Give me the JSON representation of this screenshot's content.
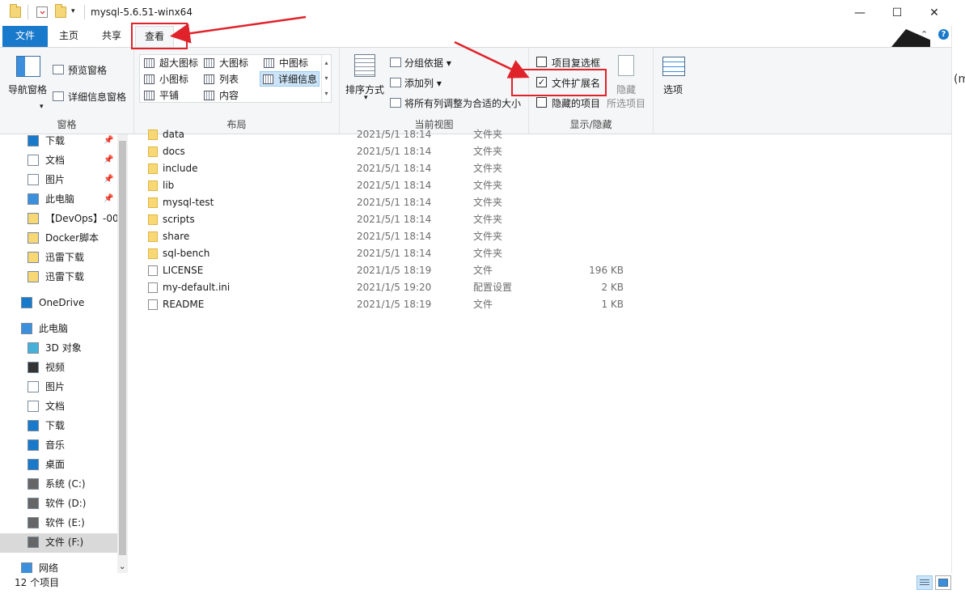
{
  "window": {
    "title": "mysql-5.6.51-winx64",
    "controls": {
      "minimize": "—",
      "maximize": "☐",
      "close": "✕"
    },
    "overflow_char": "(m"
  },
  "tabs": {
    "file": "文件",
    "home": "主页",
    "share": "共享",
    "view": "查看"
  },
  "ribbon": {
    "help_glyph": "?",
    "collapse_glyph": "⌃",
    "panes": {
      "nav_pane": "导航窗格",
      "preview_pane": "预览窗格",
      "details_pane": "详细信息窗格",
      "group_label": "窗格"
    },
    "layout": {
      "extra_large": "超大图标",
      "large": "大图标",
      "medium": "中图标",
      "small": "小图标",
      "list": "列表",
      "details": "详细信息",
      "tiles": "平铺",
      "content": "内容",
      "group_label": "布局"
    },
    "current_view": {
      "sort_by": "排序方式",
      "group_by": "分组依据",
      "add_columns": "添加列",
      "size_all_columns": "将所有列调整为合适的大小",
      "group_label": "当前视图"
    },
    "show_hide": {
      "item_checkboxes": {
        "label": "项目复选框",
        "checked": false
      },
      "file_extensions": {
        "label": "文件扩展名",
        "checked": true
      },
      "hidden_items": {
        "label": "隐藏的项目",
        "checked": false
      },
      "hide_selected_line1": "隐藏",
      "hide_selected_line2": "所选项目",
      "group_label": "显示/隐藏"
    },
    "options": "选项",
    "check_mark": "✓"
  },
  "nav": {
    "pin_glyph": "📌",
    "expand_glyph": "⌄",
    "items": [
      {
        "label": "下载",
        "pinned": true
      },
      {
        "label": "文档",
        "pinned": true
      },
      {
        "label": "图片",
        "pinned": true
      },
      {
        "label": "此电脑",
        "pinned": true
      },
      {
        "label": "【DevOps】-00"
      },
      {
        "label": "Docker脚本"
      },
      {
        "label": "迅雷下载"
      },
      {
        "label": "迅雷下载"
      },
      {
        "label": "OneDrive"
      },
      {
        "label": "此电脑"
      },
      {
        "label": "3D 对象"
      },
      {
        "label": "视频"
      },
      {
        "label": "图片"
      },
      {
        "label": "文档"
      },
      {
        "label": "下载"
      },
      {
        "label": "音乐"
      },
      {
        "label": "桌面"
      },
      {
        "label": "系统 (C:)"
      },
      {
        "label": "软件 (D:)"
      },
      {
        "label": "软件 (E:)"
      },
      {
        "label": "文件 (F:)"
      },
      {
        "label": "网络"
      }
    ]
  },
  "files": [
    {
      "name": "data",
      "date": "2021/5/1 18:14",
      "type": "文件夹",
      "size": ""
    },
    {
      "name": "docs",
      "date": "2021/5/1 18:14",
      "type": "文件夹",
      "size": ""
    },
    {
      "name": "include",
      "date": "2021/5/1 18:14",
      "type": "文件夹",
      "size": ""
    },
    {
      "name": "lib",
      "date": "2021/5/1 18:14",
      "type": "文件夹",
      "size": ""
    },
    {
      "name": "mysql-test",
      "date": "2021/5/1 18:14",
      "type": "文件夹",
      "size": ""
    },
    {
      "name": "scripts",
      "date": "2021/5/1 18:14",
      "type": "文件夹",
      "size": ""
    },
    {
      "name": "share",
      "date": "2021/5/1 18:14",
      "type": "文件夹",
      "size": ""
    },
    {
      "name": "sql-bench",
      "date": "2021/5/1 18:14",
      "type": "文件夹",
      "size": ""
    },
    {
      "name": "LICENSE",
      "date": "2021/1/5 18:19",
      "type": "文件",
      "size": "196 KB"
    },
    {
      "name": "my-default.ini",
      "date": "2021/1/5 19:20",
      "type": "配置设置",
      "size": "2 KB"
    },
    {
      "name": "README",
      "date": "2021/1/5 18:19",
      "type": "文件",
      "size": "1 KB"
    }
  ],
  "status": {
    "item_count": "12 个项目"
  },
  "colors": {
    "accent": "#1979ca",
    "annotation_red": "#e0232b",
    "folder": "#f8d775"
  }
}
